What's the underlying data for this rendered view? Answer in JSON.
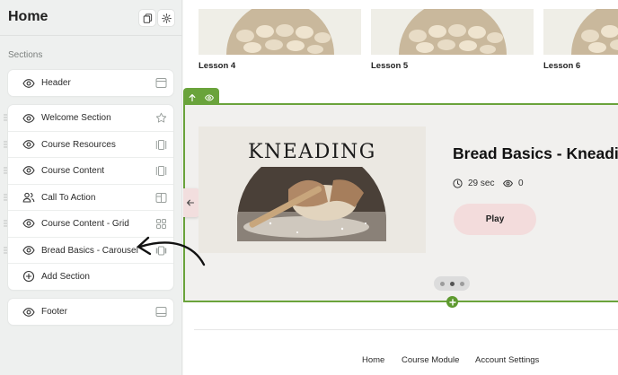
{
  "sidebar": {
    "title": "Home",
    "sections_label": "Sections",
    "header_item": {
      "label": "Header",
      "icon": "layout-header-icon"
    },
    "items": [
      {
        "label": "Welcome Section",
        "icon": "star-icon"
      },
      {
        "label": "Course Resources",
        "icon": "columns-icon"
      },
      {
        "label": "Course Content",
        "icon": "columns-icon"
      },
      {
        "label": "Call To Action",
        "icon": "layout-columns-icon"
      },
      {
        "label": "Course Content - Grid",
        "icon": "grid-icon"
      },
      {
        "label": "Bread Basics - Carousel",
        "icon": "carousel-icon"
      }
    ],
    "add_section_label": "Add Section",
    "footer_item": {
      "label": "Footer",
      "icon": "layout-footer-icon"
    }
  },
  "lessons": [
    {
      "label": "Lesson 4"
    },
    {
      "label": "Lesson 5"
    },
    {
      "label": "Lesson 6"
    }
  ],
  "carousel": {
    "image_title": "KNEADING",
    "course_title": "Bread Basics - Kneading",
    "duration": "29 sec",
    "views": "0",
    "play_label": "Play"
  },
  "footer_nav": [
    "Home",
    "Course Module",
    "Account Settings"
  ],
  "colors": {
    "selection_green": "#6aa33b",
    "play_button": "#f3dcdc",
    "sidebar_bg": "#eef0ef"
  }
}
